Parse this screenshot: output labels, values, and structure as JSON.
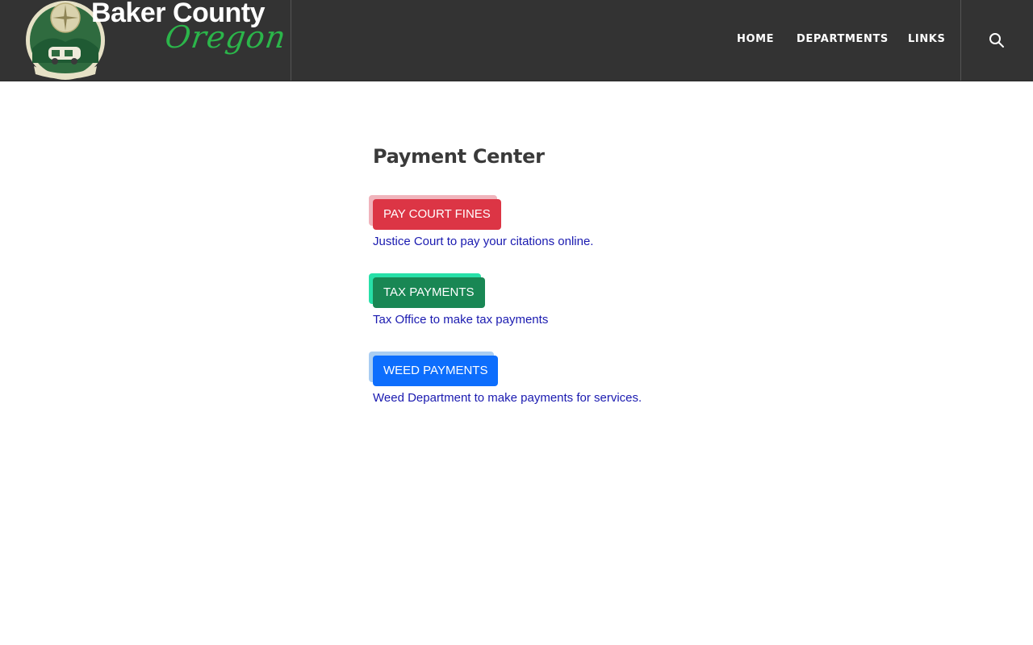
{
  "header": {
    "site_name": "Baker County",
    "site_state": "Oregon",
    "seal_text": "BAKER COUNTY",
    "nav": [
      "HOME",
      "DEPARTMENTS",
      "LINKS"
    ],
    "search_icon": "search-icon"
  },
  "main": {
    "title": "Payment Center",
    "payments": [
      {
        "label": "PAY COURT FINES",
        "description": "Justice Court to pay your citations online.",
        "color": "#dc3545",
        "shadow": "#f0b4bc"
      },
      {
        "label": "TAX PAYMENTS",
        "description": "Tax Office to make tax payments",
        "color": "#198754",
        "shadow": "#27e0a8"
      },
      {
        "label": "WEED PAYMENTS",
        "description": "Weed Department to make payments for services.",
        "color": "#0d6efd",
        "shadow": "#a9cdf2"
      }
    ]
  },
  "colors": {
    "header_bg": "#333333",
    "title_text": "#3a3a3a",
    "link_text": "#1a1ab0",
    "state_script": "#2bb54a"
  }
}
